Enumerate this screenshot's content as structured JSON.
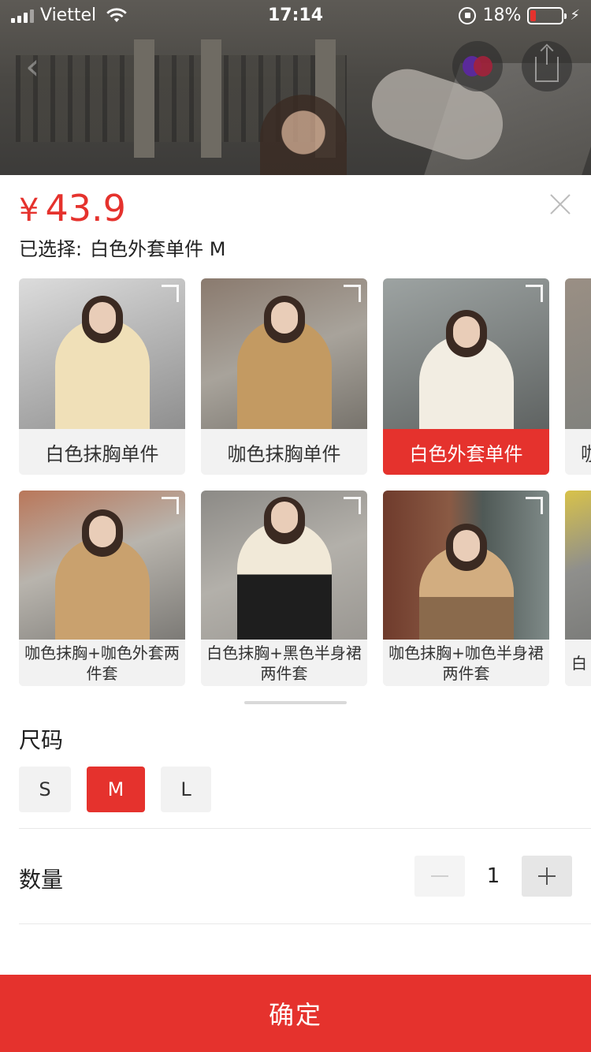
{
  "status_bar": {
    "carrier": "Viettel",
    "time": "17:14",
    "battery": "18%",
    "battery_level": 0.18,
    "icons": [
      "signal-icon",
      "wifi-icon",
      "rotation-lock-icon",
      "battery-icon",
      "charging-icon"
    ]
  },
  "header": {
    "icons": [
      "back-icon",
      "brand-heart-icon",
      "share-icon"
    ]
  },
  "product": {
    "currency": "¥",
    "price": "43.9",
    "selected_label": "已选择:",
    "selected_value": "白色外套单件 M"
  },
  "styles": {
    "row1": [
      {
        "label": "白色抹胸单件",
        "active": false
      },
      {
        "label": "咖色抹胸单件",
        "active": false
      },
      {
        "label": "白色外套单件",
        "active": true
      },
      {
        "label": "咖",
        "active": false
      }
    ],
    "row2": [
      {
        "label": "咖色抹胸+咖色外套两件套",
        "active": false
      },
      {
        "label": "白色抹胸+黑色半身裙两件套",
        "active": false
      },
      {
        "label": "咖色抹胸+咖色半身裙两件套",
        "active": false
      },
      {
        "label": "白",
        "active": false
      }
    ]
  },
  "size": {
    "title": "尺码",
    "options": [
      {
        "label": "S",
        "active": false
      },
      {
        "label": "M",
        "active": true
      },
      {
        "label": "L",
        "active": false
      }
    ]
  },
  "quantity": {
    "title": "数量",
    "value": "1"
  },
  "confirm_label": "确定",
  "colors": {
    "accent": "#e5322d",
    "chip_bg": "#f2f2f2"
  }
}
